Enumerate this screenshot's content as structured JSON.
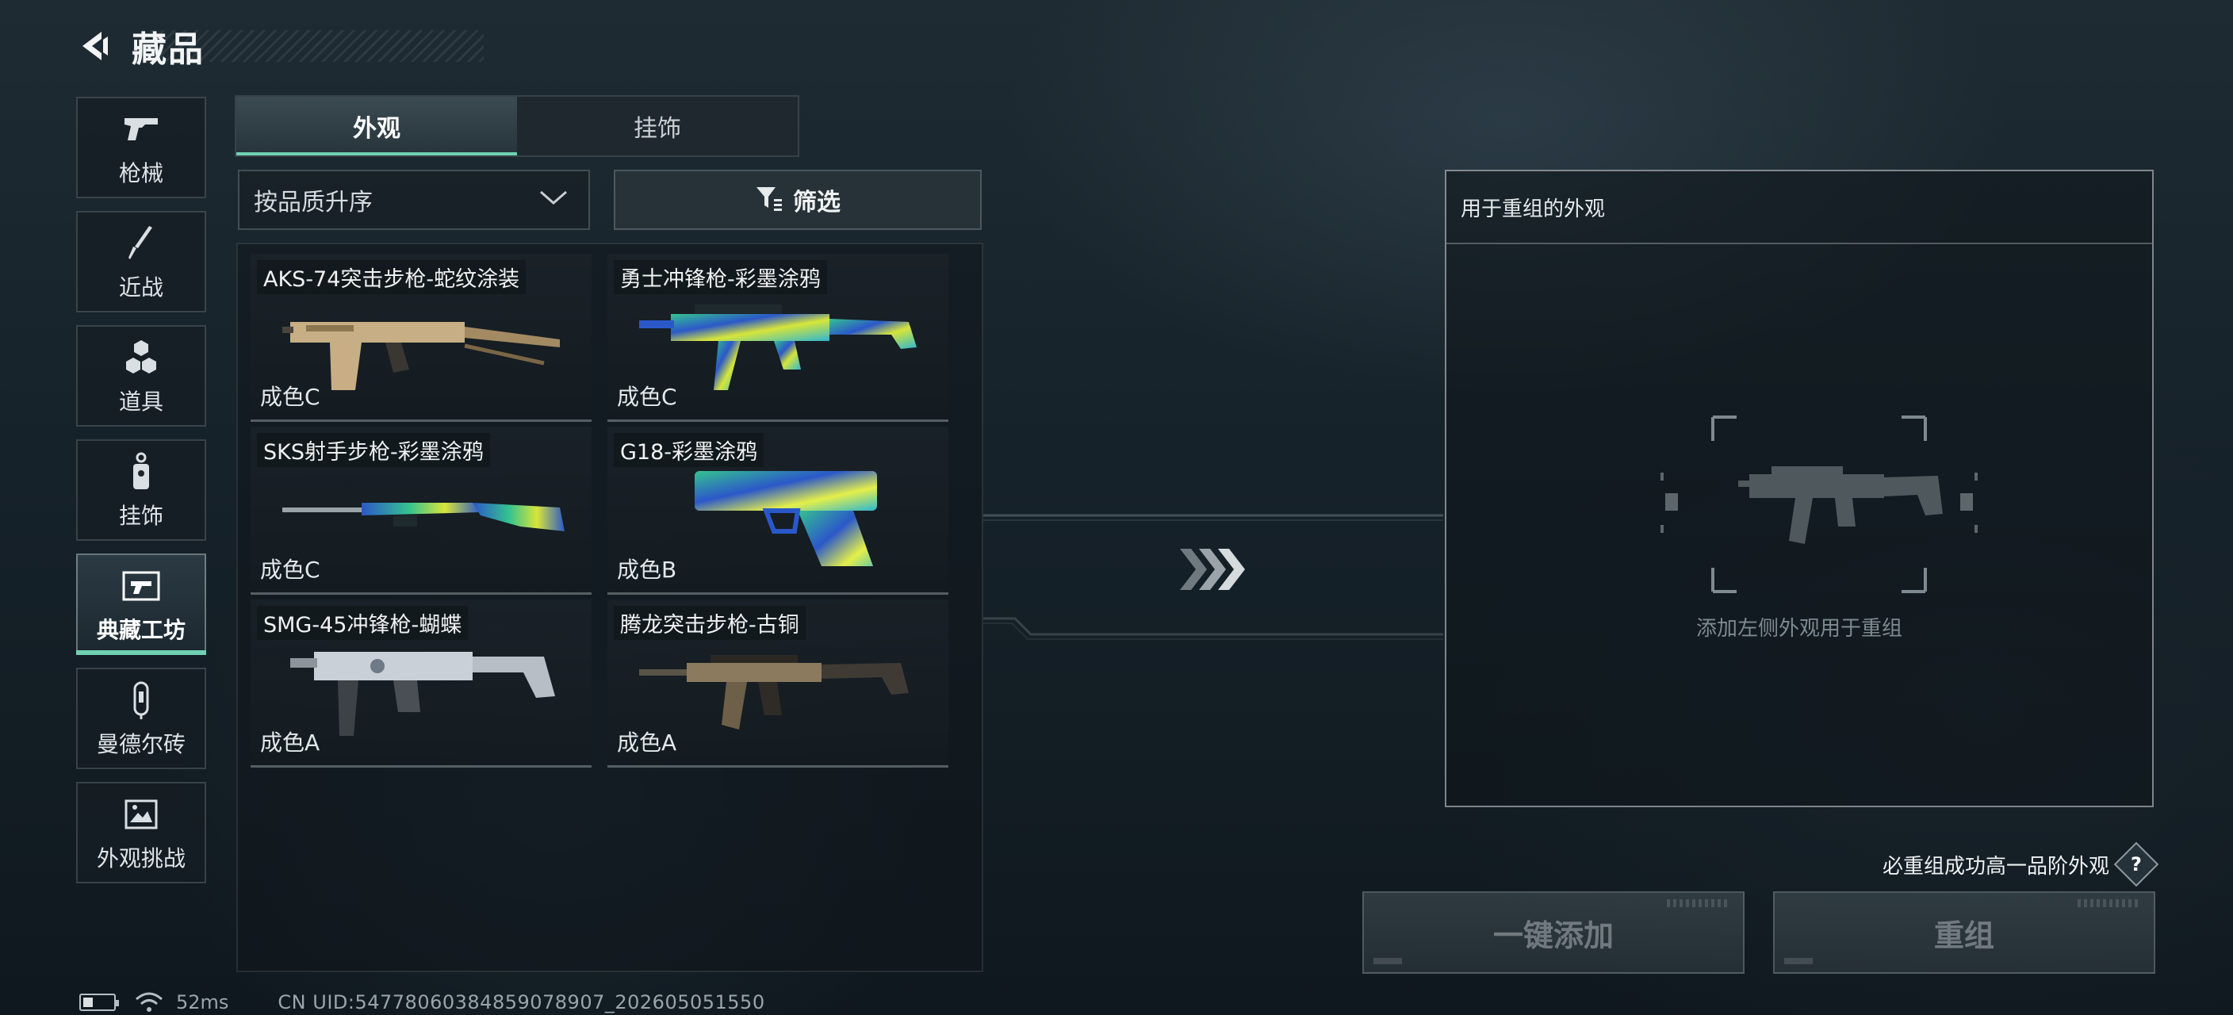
{
  "header": {
    "title": "藏品"
  },
  "sidebar": {
    "items": [
      {
        "label": "枪械",
        "icon": "pistol-icon",
        "active": false
      },
      {
        "label": "近战",
        "icon": "knife-icon",
        "active": false
      },
      {
        "label": "道具",
        "icon": "hexagon-cluster-icon",
        "active": false
      },
      {
        "label": "挂饰",
        "icon": "keychain-icon",
        "active": false
      },
      {
        "label": "典藏工坊",
        "icon": "workshop-frame-icon",
        "active": true
      },
      {
        "label": "曼德尔砖",
        "icon": "brick-capsule-icon",
        "active": false
      },
      {
        "label": "外观挑战",
        "icon": "challenge-card-icon",
        "active": false
      }
    ]
  },
  "tabs": [
    {
      "label": "外观",
      "active": true
    },
    {
      "label": "挂饰",
      "active": false
    }
  ],
  "sort": {
    "value": "按品质升序"
  },
  "filter": {
    "label": "筛选"
  },
  "items": [
    {
      "name": "AKS-74突击步枪-蛇纹涂装",
      "grade": "成色C",
      "skin": "snake-camo"
    },
    {
      "name": "勇士冲锋枪-彩墨涂鸦",
      "grade": "成色C",
      "skin": "ink-graffiti"
    },
    {
      "name": "SKS射手步枪-彩墨涂鸦",
      "grade": "成色C",
      "skin": "ink-graffiti"
    },
    {
      "name": "G18-彩墨涂鸦",
      "grade": "成色B",
      "skin": "ink-graffiti"
    },
    {
      "name": "SMG-45冲锋枪-蝴蝶",
      "grade": "成色A",
      "skin": "butterfly"
    },
    {
      "name": "腾龙突击步枪-古铜",
      "grade": "成色A",
      "skin": "bronze"
    }
  ],
  "recombine": {
    "title": "用于重组的外观",
    "hint": "添加左侧外观用于重组"
  },
  "guarantee": {
    "text": "必重组成功高一品阶外观",
    "help": "?"
  },
  "actions": {
    "add_all": "一键添加",
    "recombine": "重组"
  },
  "status": {
    "ping": "52ms",
    "uid": "CN UID:54778060384859078907_202605051550"
  },
  "colors": {
    "accent": "#6fd0b2",
    "panel_border": "#c8cdd2",
    "disabled_text": "#c8ced2"
  }
}
